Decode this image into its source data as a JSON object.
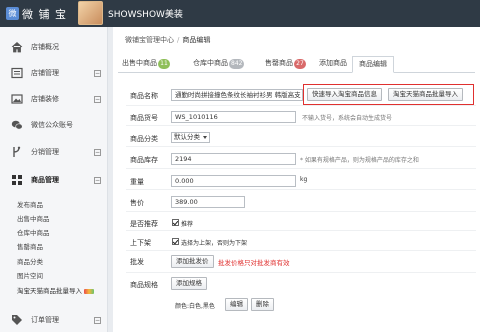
{
  "topbar": {
    "logo_glyph": "微",
    "brand": "微 铺 宝",
    "shop_name": "SHOWSHOW美装"
  },
  "sidebar": {
    "items": [
      {
        "label": "店铺概况",
        "icon": "home-icon",
        "expandable": false
      },
      {
        "label": "店铺管理",
        "icon": "list-icon",
        "expandable": true
      },
      {
        "label": "店铺装修",
        "icon": "image-icon",
        "expandable": true
      },
      {
        "label": "微信公众账号",
        "icon": "wechat-icon",
        "expandable": false
      },
      {
        "label": "分销管理",
        "icon": "fork-icon",
        "expandable": true
      },
      {
        "label": "商品管理",
        "icon": "grid-icon",
        "expandable": true
      },
      {
        "label": "订单管理",
        "icon": "tag-icon",
        "expandable": true
      }
    ],
    "sub_items": [
      "发布商品",
      "出售中商品",
      "仓库中商品",
      "售罄商品",
      "商品分类",
      "图片空间",
      "淘宝天猫商品批量导入"
    ]
  },
  "breadcrumb": {
    "root": "微铺宝管理中心",
    "sep": "/",
    "current": "商品编辑"
  },
  "tabs": [
    {
      "label": "出售中商品",
      "badge": "11",
      "badge_color": "#8fbf5a"
    },
    {
      "label": "仓库中商品",
      "badge": "842",
      "badge_color": "#b4b8bd"
    },
    {
      "label": "售罄商品",
      "badge": "27",
      "badge_color": "#d96a6a"
    },
    {
      "label": "添加商品",
      "badge": null
    },
    {
      "label": "商品编辑",
      "badge": null,
      "active": true
    }
  ],
  "form": {
    "name_label": "商品名称",
    "name_value": "通勤时尚拼接撞色条纹长袖衬衫男 韩版高支",
    "import_taobao_btn": "快速导入淘宝商品信息",
    "import_batch_btn": "淘宝天猫商品批量导入",
    "sku_label": "商品货号",
    "sku_value": "WS_1010116",
    "sku_hint": "不输入货号，系统会自动生成货号",
    "category_label": "商品分类",
    "category_value": "默认分类",
    "stock_label": "商品库存",
    "stock_value": "2194",
    "stock_hint": "* 如果有规格产品，则为规格产品的库存之和",
    "weight_label": "重量",
    "weight_value": "0.000",
    "weight_unit": "kg",
    "price_label": "售价",
    "price_value": "389.00",
    "recommend_label": "是否推荐",
    "recommend_text": "推荐",
    "shelf_label": "上下架",
    "shelf_text": "选择为上架，否则为下架",
    "wholesale_label": "批发",
    "wholesale_btn": "添加批发价",
    "wholesale_warn": "批发价格只对批发商有效",
    "spec_label": "商品规格",
    "spec_btn": "添加规格",
    "spec_value": "颜色:白色,黑色",
    "spec_edit": "编辑",
    "spec_delete": "删除"
  }
}
